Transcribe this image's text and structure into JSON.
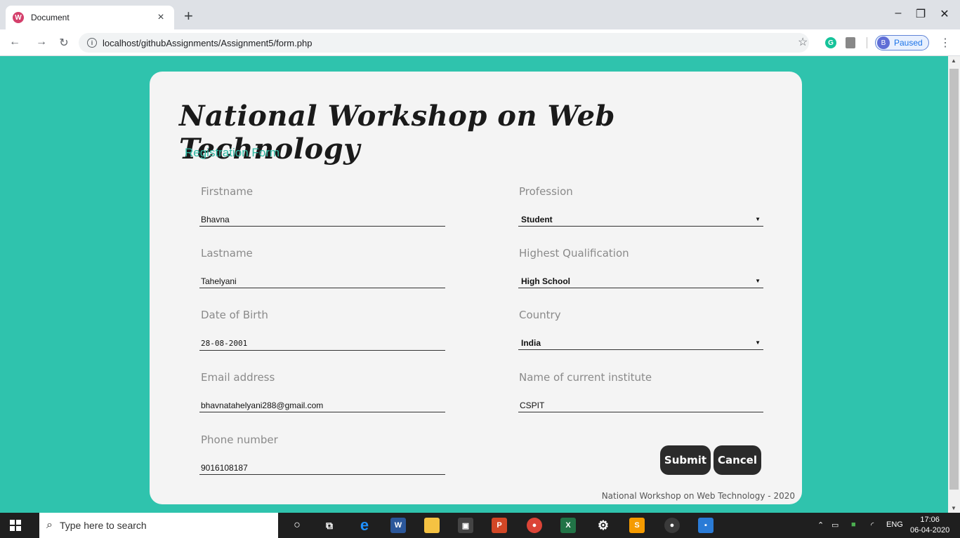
{
  "browser": {
    "tab_title": "Document",
    "url": "localhost/githubAssignments/Assignment5/form.php",
    "profile_initial": "B",
    "profile_status": "Paused",
    "favicon_letter": "W",
    "ext_letter": "G"
  },
  "page": {
    "title": "National Workshop on Web Technology",
    "subtitle": "Registration Form",
    "fields": {
      "firstname": {
        "label": "Firstname",
        "value": "Bhavna"
      },
      "lastname": {
        "label": "Lastname",
        "value": "Tahelyani"
      },
      "dob": {
        "label": "Date of Birth",
        "value": "28-08-2001"
      },
      "email": {
        "label": "Email address",
        "value": "bhavnatahelyani288@gmail.com"
      },
      "phone": {
        "label": "Phone number",
        "value": "9016108187"
      },
      "profession": {
        "label": "Profession",
        "value": "Student"
      },
      "qualification": {
        "label": "Highest Qualification",
        "value": "High School"
      },
      "country": {
        "label": "Country",
        "value": "India"
      },
      "institute": {
        "label": "Name of current institute",
        "value": "CSPIT"
      }
    },
    "buttons": {
      "submit": "Submit",
      "cancel": "Cancel"
    },
    "footer": "National Workshop on Web Technology - 2020"
  },
  "taskbar": {
    "search_placeholder": "Type here to search",
    "language": "ENG",
    "time": "17:06",
    "date": "06-04-2020"
  }
}
